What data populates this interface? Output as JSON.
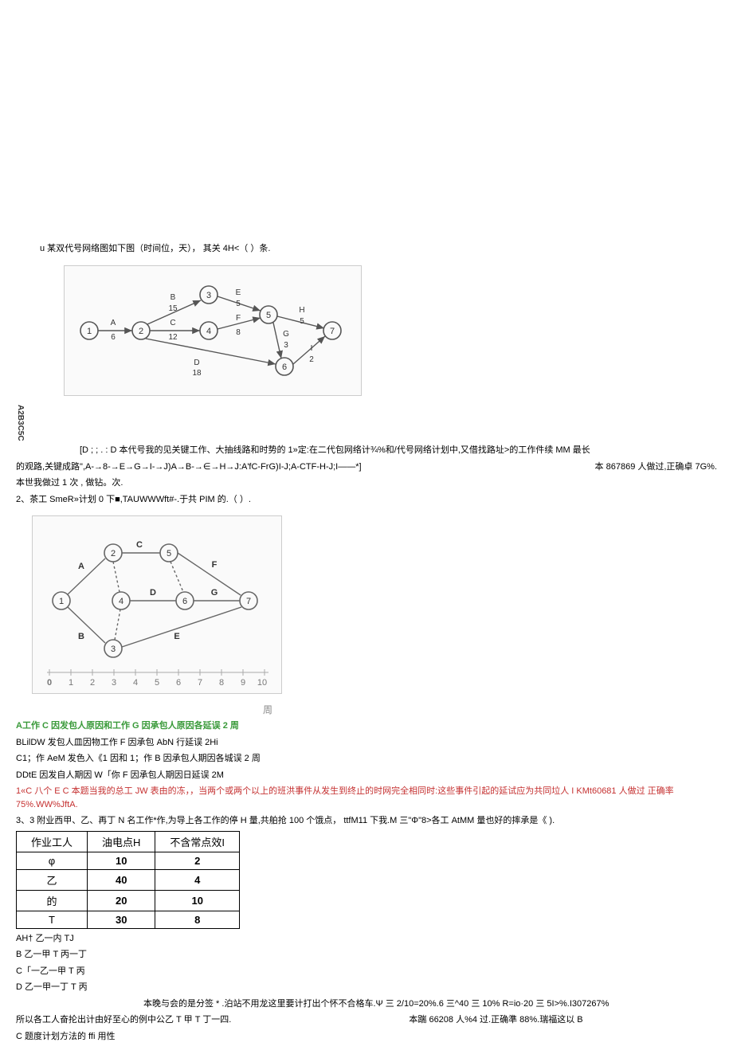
{
  "q1": {
    "intro": "u 某双代号网络图如下图（时间位，天）， 其关 4H<（ ）条.",
    "vert_label": "A2B3C5C",
    "options_line1": "[D ;          ; . : D 本代号我的见关键工作、大抽线路和时势的 1»定:在二代包网络计¾%和/代号网络计划中,又借找路址>的工作件续 MM 最长",
    "options_line2": "的观路,关键成路\",A-→8-→E→G→I-→J)A→B-→∈→H→J:A'fC-FrG)I-J;A-CTF-H-J;I――*]",
    "stats": "本 867869 人做过,正确卓 7G%.",
    "done": "本世我做过 1 次 , 做钻。次."
  },
  "q2": {
    "intro": "2、茶工 SmeR»计划 0 下■,TAUWWWft#-.于共 PIM 的.（ ）.",
    "axis_labels": [
      "0",
      "1",
      "2",
      "3",
      "4",
      "5",
      "6",
      "7",
      "8",
      "9",
      "10",
      "周"
    ],
    "answer_a": "A工作 C 因发包人原因和工作 G 因承包人原因各延误 2 周",
    "answer_b": "BLilDW 发包人皿因物工作 F 因承包 AbN 行延误 2Hi",
    "answer_c": "C1；作 AeM 发色入《1 因和 1；作 B 因承包人期因各城误 2 周",
    "answer_d": "DDtE 因发自人期因 W「你 F 因承包人期因日延误 2M",
    "hint": "1«C 八个 E C 本题当我的总工 JW 表由的冻，，当两个或两个以上的班洪事件从发生到终止的时网完全相同时:这些事件引起的延试应为共同垃人 I KMt60681 人做过 正确率 75%.WW%JftA."
  },
  "q3": {
    "intro": "3、3 附业西甲、乙、再丁 N 名工作*作,为导上各工作的停 H 量,共舶抢 100 个饿点， ttfM11 下我.M 三\"Φ\"8>各工 AtMM 量也好的摔承是《 ).",
    "table": {
      "headers": [
        "作业工人",
        "油电点H",
        "不含常点效I"
      ],
      "rows": [
        [
          "φ",
          "10",
          "2"
        ],
        [
          "乙",
          "40",
          "4"
        ],
        [
          "的",
          "20",
          "10"
        ],
        [
          "T",
          "30",
          "8"
        ]
      ]
    },
    "opt_a": "AH† 乙一内 TJ",
    "opt_b": "B 乙一甲 T 丙一丁",
    "opt_c": "C「一乙一甲 T 丙",
    "opt_d": "D 乙一甲一丁 T 丙",
    "note1": "本晚与会的是分签 * .泊站不用龙这里要计打出个怀不合格车.Ψ 三 2/10=20%.6 三^40 三 10% R=io·20 三 5I>%.I307267%",
    "note2": "所以各工人奋抡出计由好至心的例中公乙 T 甲 T 丁一四.",
    "note2_right": "本踹 66208 人%4 过.正确準 88%.瑞福这以 B",
    "note3": "C 题度计划方法的 ffi 用性"
  },
  "chart_data": [
    {
      "type": "network-diagram",
      "nodes": [
        1,
        2,
        3,
        4,
        5,
        6,
        7
      ],
      "edges": [
        {
          "from": 1,
          "to": 2,
          "label": "A",
          "dur": 6
        },
        {
          "from": 2,
          "to": 3,
          "label": "B",
          "dur": 15
        },
        {
          "from": 2,
          "to": 4,
          "label": "C",
          "dur": 12
        },
        {
          "from": 2,
          "to": 6,
          "label": "D",
          "dur": 18
        },
        {
          "from": 3,
          "to": 5,
          "label": "E",
          "dur": 5
        },
        {
          "from": 4,
          "to": 5,
          "label": "F",
          "dur": 8
        },
        {
          "from": 5,
          "to": 6,
          "label": "G",
          "dur": 3
        },
        {
          "from": 5,
          "to": 7,
          "label": "H",
          "dur": 5
        },
        {
          "from": 6,
          "to": 7,
          "label": "I",
          "dur": 2
        }
      ]
    },
    {
      "type": "time-scaled-network",
      "xlabel": "周",
      "x_ticks": [
        0,
        1,
        2,
        3,
        4,
        5,
        6,
        7,
        8,
        9,
        10
      ],
      "nodes": [
        1,
        2,
        3,
        4,
        5,
        6,
        7
      ],
      "activities": [
        "A",
        "B",
        "C",
        "D",
        "E",
        "F",
        "G"
      ]
    }
  ]
}
